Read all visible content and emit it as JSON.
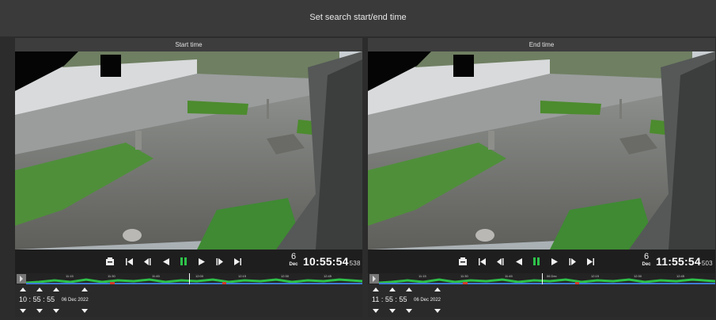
{
  "header": {
    "title": "Set search start/end time"
  },
  "panels": [
    {
      "title": "Start time",
      "date_day": "6",
      "date_month": "Dec",
      "clock": "10:55:54",
      "ms": "538",
      "timeline_ticks": [
        "11:15",
        "11:30",
        "11:45",
        "",
        "12:00",
        "12:15",
        "12:30",
        "12:45"
      ],
      "spinner": {
        "hh": "10",
        "mm": "55",
        "ss": "55",
        "sep": ":",
        "date": "06 Dec 2022"
      }
    },
    {
      "title": "End time",
      "date_day": "6",
      "date_month": "Dec",
      "clock": "11:55:54",
      "ms": "503",
      "timeline_ticks": [
        "11:15",
        "11:30",
        "11:45",
        "06 Dec",
        "12:15",
        "12:30",
        "12:45"
      ],
      "spinner": {
        "hh": "11",
        "mm": "55",
        "ss": "55",
        "sep": ":",
        "date": "06 Dec 2022"
      }
    }
  ],
  "icons": [
    "snapshot-icon",
    "skip-start-icon",
    "step-back-icon",
    "play-reverse-icon",
    "pause-icon",
    "play-icon",
    "step-forward-icon",
    "skip-end-icon"
  ],
  "colors": {
    "accent": "#2ec24a",
    "timeline_green": "#2ec24a",
    "timeline_blue": "#3d7bd6",
    "timeline_red": "#d23b2b"
  }
}
